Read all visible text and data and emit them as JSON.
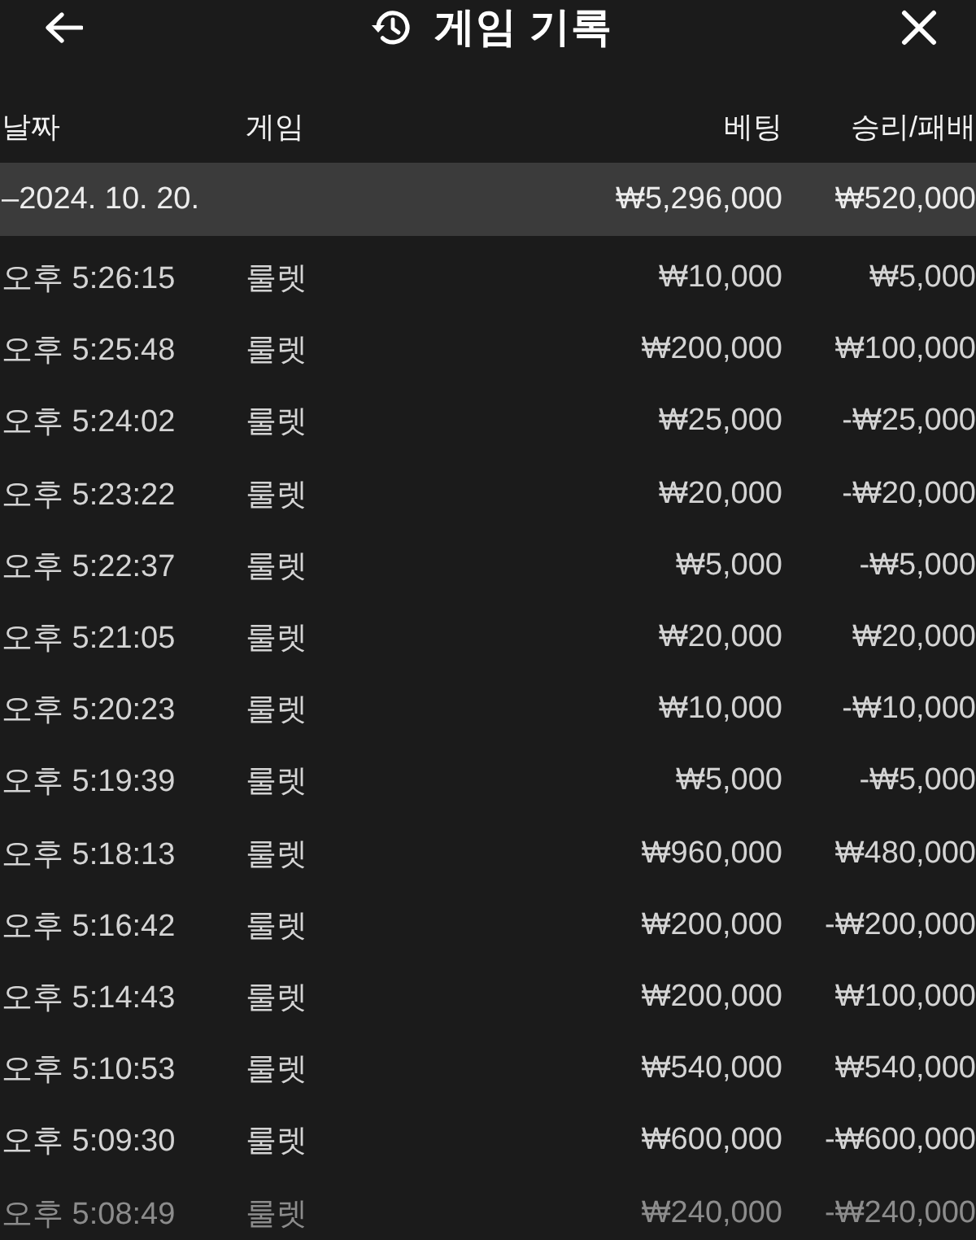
{
  "header": {
    "title": "게임 기록"
  },
  "table": {
    "columns": [
      "날짜",
      "게임",
      "베팅",
      "승리/패배"
    ],
    "groups": [
      {
        "date": "–2024. 10. 20.",
        "bet_total": "₩5,296,000",
        "result_total": "₩520,000",
        "rows": [
          {
            "time": "오후 5:26:15",
            "game": "룰렛",
            "bet": "₩10,000",
            "result": "₩5,000"
          },
          {
            "time": "오후 5:25:48",
            "game": "룰렛",
            "bet": "₩200,000",
            "result": "₩100,000"
          },
          {
            "time": "오후 5:24:02",
            "game": "룰렛",
            "bet": "₩25,000",
            "result": "-₩25,000"
          },
          {
            "time": "오후 5:23:22",
            "game": "룰렛",
            "bet": "₩20,000",
            "result": "-₩20,000"
          },
          {
            "time": "오후 5:22:37",
            "game": "룰렛",
            "bet": "₩5,000",
            "result": "-₩5,000"
          },
          {
            "time": "오후 5:21:05",
            "game": "룰렛",
            "bet": "₩20,000",
            "result": "₩20,000"
          },
          {
            "time": "오후 5:20:23",
            "game": "룰렛",
            "bet": "₩10,000",
            "result": "-₩10,000"
          },
          {
            "time": "오후 5:19:39",
            "game": "룰렛",
            "bet": "₩5,000",
            "result": "-₩5,000"
          },
          {
            "time": "오후 5:18:13",
            "game": "룰렛",
            "bet": "₩960,000",
            "result": "₩480,000"
          },
          {
            "time": "오후 5:16:42",
            "game": "룰렛",
            "bet": "₩200,000",
            "result": "-₩200,000"
          },
          {
            "time": "오후 5:14:43",
            "game": "룰렛",
            "bet": "₩200,000",
            "result": "₩100,000"
          },
          {
            "time": "오후 5:10:53",
            "game": "룰렛",
            "bet": "₩540,000",
            "result": "₩540,000"
          },
          {
            "time": "오후 5:09:30",
            "game": "룰렛",
            "bet": "₩600,000",
            "result": "-₩600,000"
          },
          {
            "time": "오후 5:08:49",
            "game": "룰렛",
            "bet": "₩240,000",
            "result": "-₩240,000"
          }
        ]
      }
    ]
  }
}
